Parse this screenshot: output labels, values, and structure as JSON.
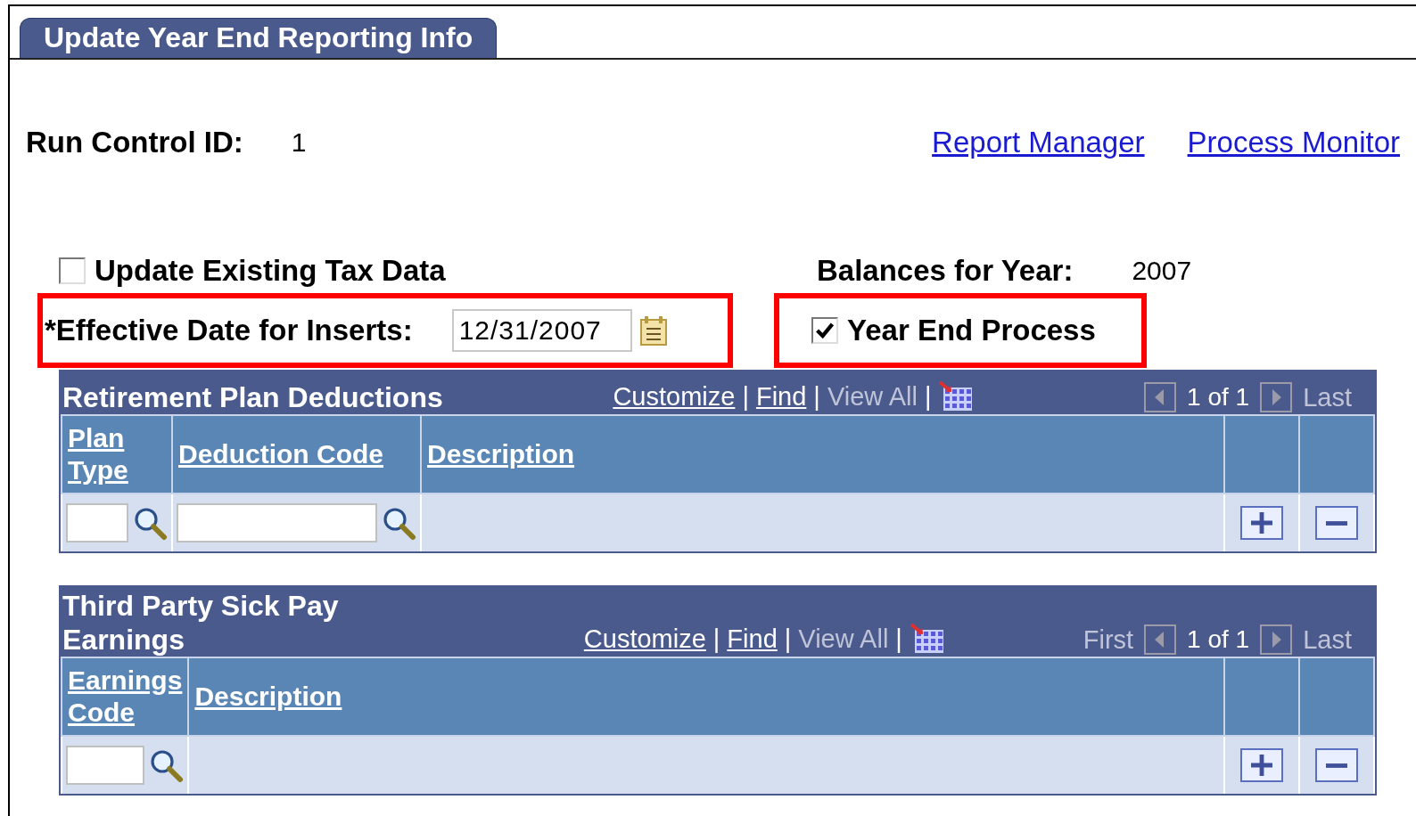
{
  "tab": {
    "label": "Update Year End Reporting Info",
    "selected": true
  },
  "run_control": {
    "label": "Run Control ID:",
    "value": "1"
  },
  "links": [
    "Report Manager",
    "Process Monitor"
  ],
  "update_existing": {
    "label": "Update Existing Tax Data",
    "checked": false
  },
  "balances": {
    "label": "Balances for Year:",
    "value": "2007"
  },
  "effective_date": {
    "label": "*Effective Date for Inserts:",
    "value": "12/31/2007",
    "highlighted": true
  },
  "year_end": {
    "label": "Year End Process",
    "checked": true,
    "highlighted": true
  },
  "grids": [
    {
      "title": "Retirement Plan Deductions",
      "nav": [
        {
          "label": "Customize",
          "kind": "link"
        },
        {
          "label": "|",
          "kind": "separator"
        },
        {
          "label": "Find",
          "kind": "link"
        },
        {
          "label": "|",
          "kind": "separator"
        },
        {
          "label": "View All",
          "kind": "disabled"
        },
        {
          "label": "|",
          "kind": "separator"
        }
      ],
      "pager": {
        "count": "1 of 1",
        "last": "Last"
      },
      "columns": [
        {
          "label": "Plan Type",
          "kind": "lookup"
        },
        {
          "label": "Deduction Code",
          "kind": "lookup"
        },
        {
          "label": "Description",
          "kind": "plain"
        }
      ]
    },
    {
      "title": "Third Party Sick Pay Earnings",
      "nav": [
        {
          "label": "Customize",
          "kind": "link"
        },
        {
          "label": "|",
          "kind": "separator"
        },
        {
          "label": "Find",
          "kind": "link"
        },
        {
          "label": "|",
          "kind": "separator"
        },
        {
          "label": "View All",
          "kind": "disabled"
        },
        {
          "label": "|",
          "kind": "separator"
        }
      ],
      "pager": {
        "first": "First",
        "count": "1 of 1",
        "last": "Last"
      },
      "columns": [
        {
          "label": "Earnings Code",
          "kind": "lookup"
        },
        {
          "label": "Description",
          "kind": "plain"
        }
      ]
    }
  ]
}
